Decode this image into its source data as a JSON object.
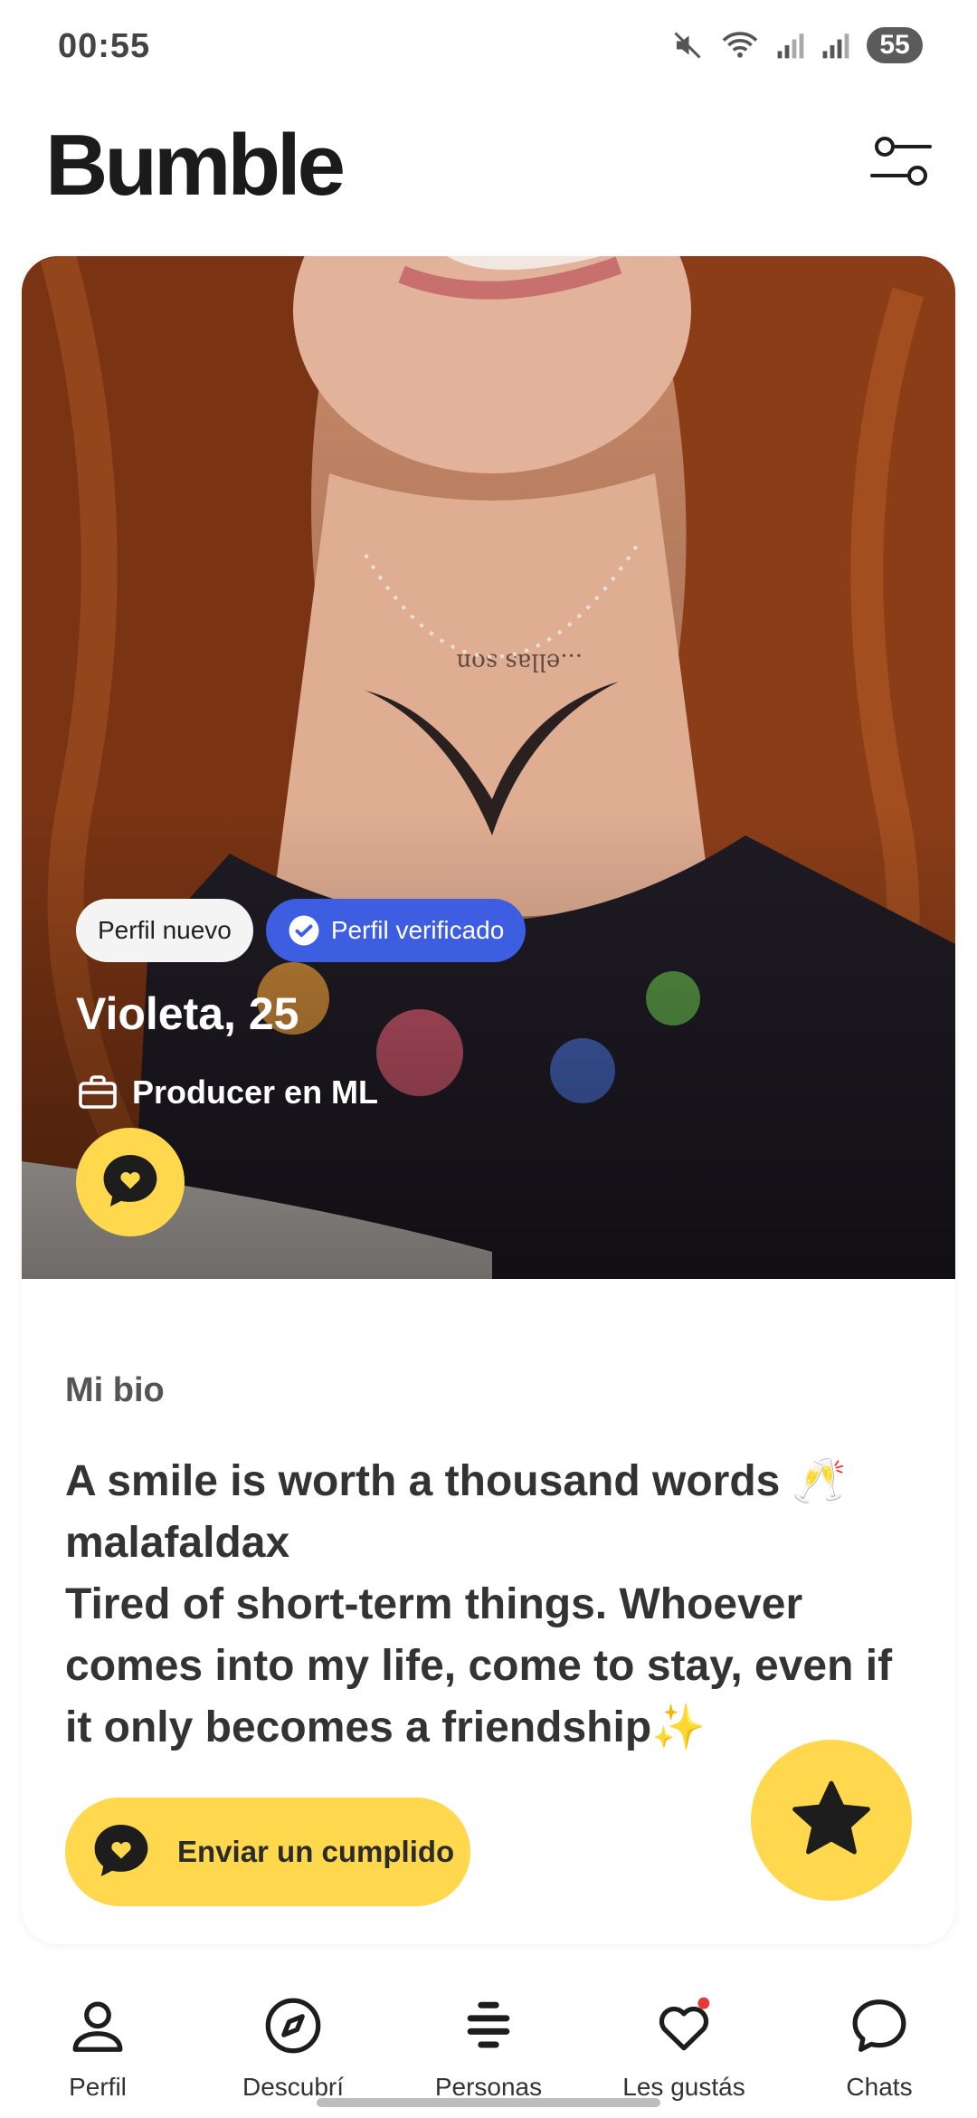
{
  "status_bar": {
    "time": "00:55",
    "battery": "55"
  },
  "header": {
    "logo": "Bumble",
    "filter_icon": "filter-sliders-icon"
  },
  "profile": {
    "badge_new": "Perfil nuevo",
    "badge_verified": "Perfil verificado",
    "name_age": "Violeta, 25",
    "job": "Producer en ML",
    "bio_label": "Mi bio",
    "bio": "A smile is worth a thousand words 🥂\nmalafaldax\nTired of short-term things. Whoever comes into my life, come to stay, even if it only becomes a friendship✨"
  },
  "actions": {
    "compliment_label": "Enviar un cumplido"
  },
  "nav": {
    "items": [
      {
        "label": "Perfil",
        "icon": "person-icon"
      },
      {
        "label": "Descubrí",
        "icon": "compass-icon"
      },
      {
        "label": "Personas",
        "icon": "people-stack-icon"
      },
      {
        "label": "Les gustás",
        "icon": "heart-icon"
      },
      {
        "label": "Chats",
        "icon": "chat-bubble-icon"
      }
    ]
  },
  "colors": {
    "accent": "#ffd84d",
    "verified": "#3d5ee0",
    "notification_dot": "#e53935"
  }
}
